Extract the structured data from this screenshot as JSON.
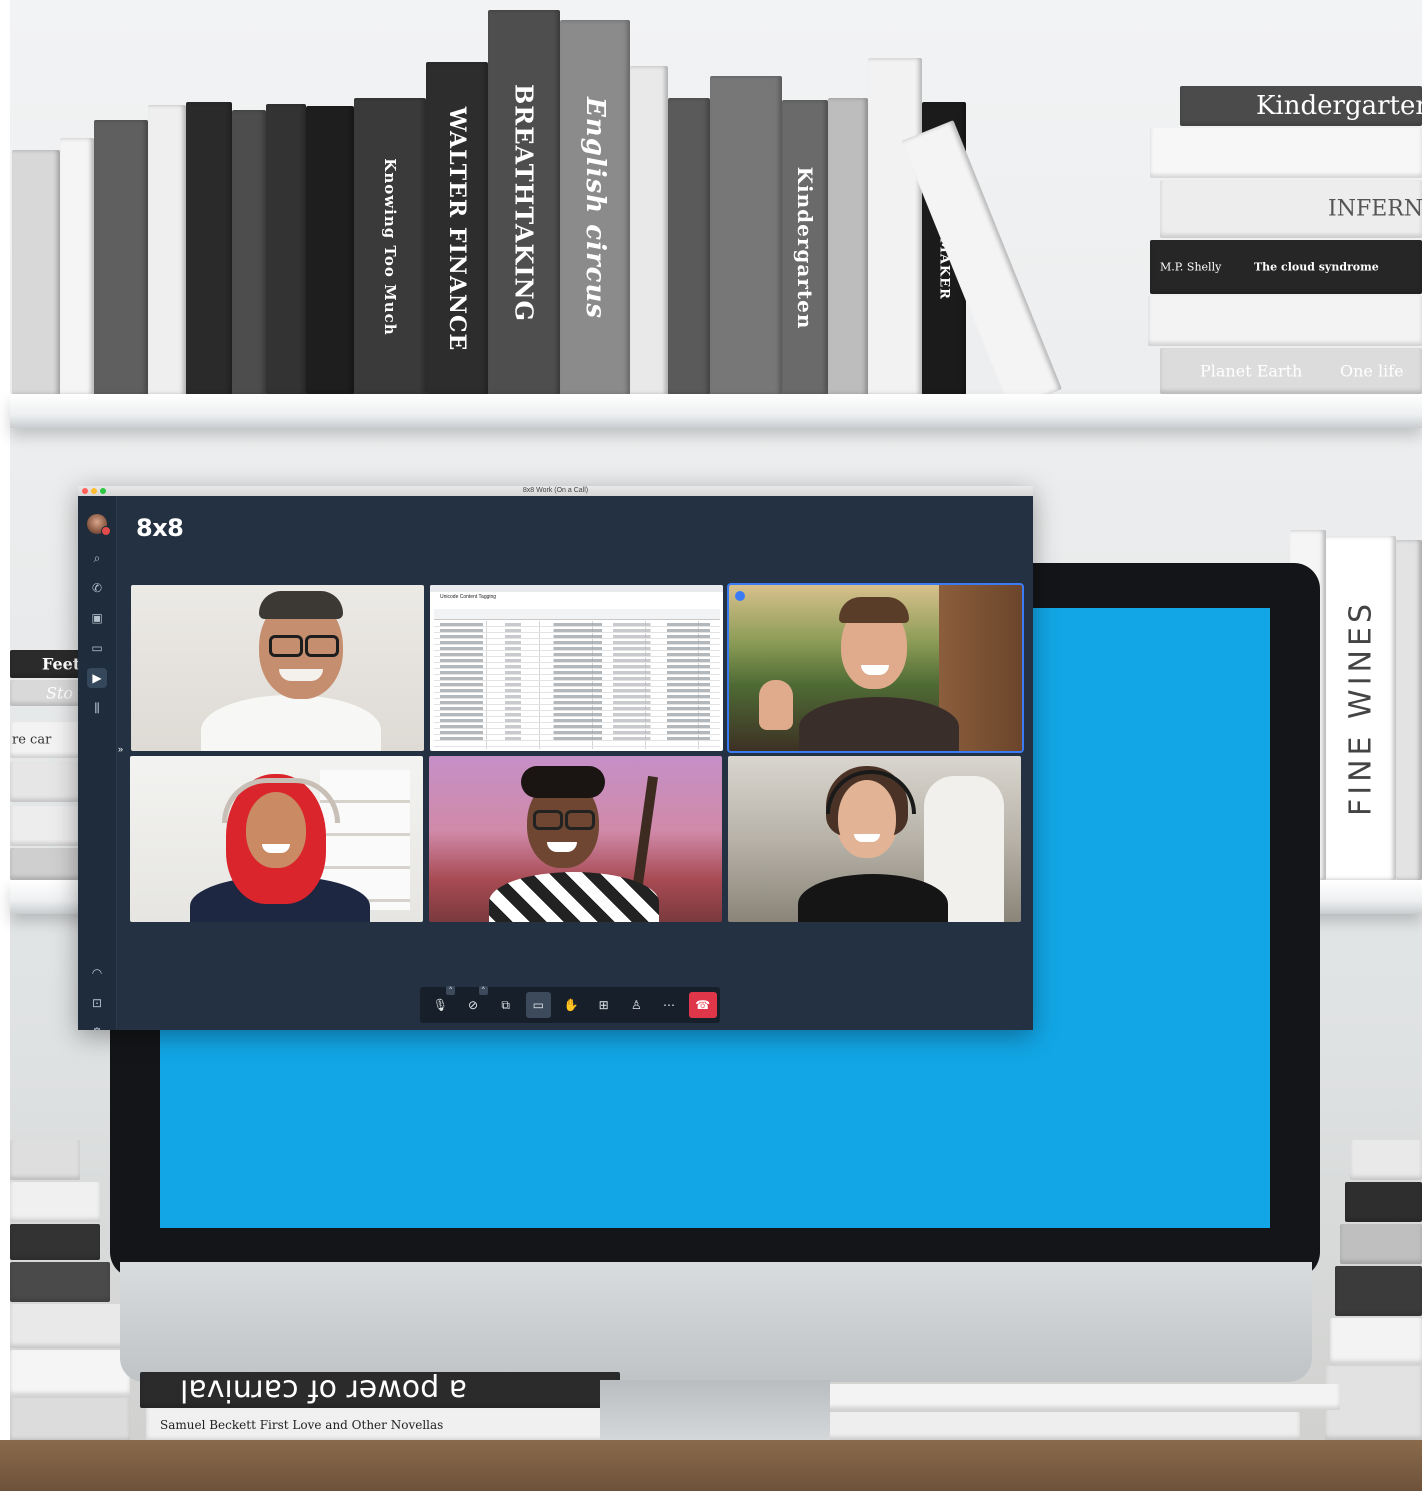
{
  "window": {
    "title": "8x8 Work (On a Call)",
    "logo": "8x8"
  },
  "sidebar": {
    "items": [
      {
        "icon": "search-icon",
        "glyph": "⌕"
      },
      {
        "icon": "phone-icon",
        "glyph": "✆"
      },
      {
        "icon": "contacts-icon",
        "glyph": "▣"
      },
      {
        "icon": "chat-icon",
        "glyph": "▭"
      },
      {
        "icon": "video-icon",
        "glyph": "▶"
      },
      {
        "icon": "voicemail-icon",
        "glyph": "⫼"
      }
    ],
    "bottom_items": [
      {
        "icon": "headset-icon",
        "glyph": "◠"
      },
      {
        "icon": "cast-icon",
        "glyph": "⊡"
      },
      {
        "icon": "settings-icon",
        "glyph": "⚙"
      }
    ],
    "expand_glyph": "»"
  },
  "sheet": {
    "title": "Unicode Content Tagging"
  },
  "controls": {
    "items": [
      {
        "name": "mute-mic-button",
        "icon": "microphone-off-icon",
        "glyph": "🎙",
        "caret": "^"
      },
      {
        "name": "camera-off-button",
        "icon": "camera-off-icon",
        "glyph": "⊘",
        "caret": "^"
      },
      {
        "name": "share-screen-button",
        "icon": "share-screen-icon",
        "glyph": "⧉"
      },
      {
        "name": "chat-button",
        "icon": "chat-icon",
        "glyph": "▭",
        "selected": true
      },
      {
        "name": "raise-hand-button",
        "icon": "hand-icon",
        "glyph": "✋"
      },
      {
        "name": "layout-button",
        "icon": "grid-icon",
        "glyph": "⊞"
      },
      {
        "name": "participants-button",
        "icon": "person-add-icon",
        "glyph": "♙"
      },
      {
        "name": "more-button",
        "icon": "more-icon",
        "glyph": "⋯"
      }
    ],
    "end_call_glyph": "☎"
  },
  "background": {
    "books_top": [
      "WALTER FINANCE",
      "BREATHTAKING",
      "English circus",
      "Kindergarten",
      "THE MAKER",
      "Knowing Too Much"
    ],
    "shelf_right": [
      "Kindergarten",
      "INFERNO",
      "M.P. Shelly",
      "The cloud syndrome",
      "Planet Earth",
      "One life"
    ],
    "right_column": [
      "FINE WINES"
    ],
    "bottom_books": [
      "a power of carnival",
      "Samuel Beckett  First Love and Other Novellas"
    ],
    "left_books": [
      "Feet",
      "Sto",
      "re car"
    ]
  }
}
